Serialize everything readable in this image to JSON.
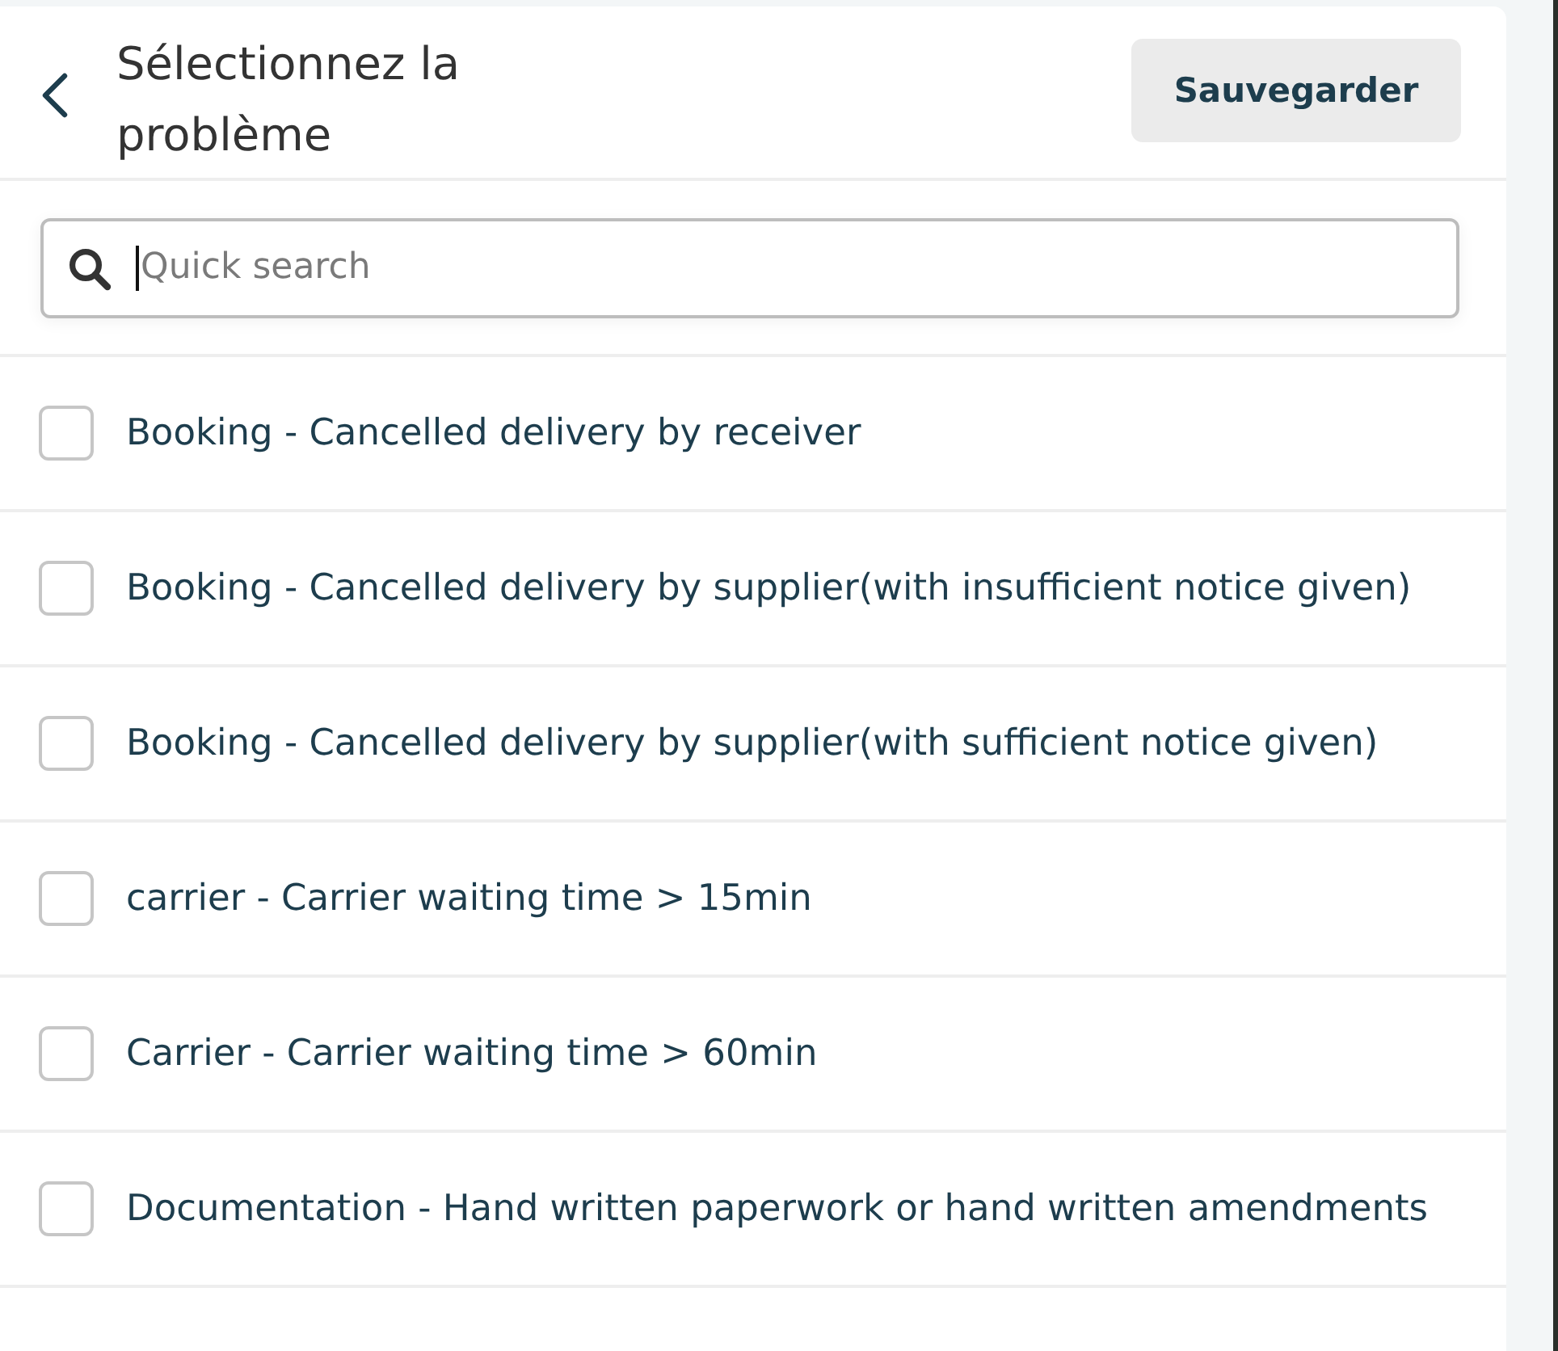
{
  "header": {
    "title": "Sélectionnez la problème",
    "save_button": "Sauvegarder"
  },
  "search": {
    "placeholder": "Quick search",
    "focused": true
  },
  "items": [
    {
      "label": "Booking - Cancelled delivery by receiver",
      "checked": false
    },
    {
      "label": "Booking - Cancelled delivery by supplier(with insufficient notice given)",
      "checked": false
    },
    {
      "label": "Booking - Cancelled delivery by supplier(with sufficient notice given)",
      "checked": false
    },
    {
      "label": "carrier - Carrier waiting time > 15min",
      "checked": false
    },
    {
      "label": "Carrier - Carrier waiting time > 60min",
      "checked": false
    },
    {
      "label": "Documentation - Hand written paperwork or hand written amendments",
      "checked": false
    }
  ]
}
